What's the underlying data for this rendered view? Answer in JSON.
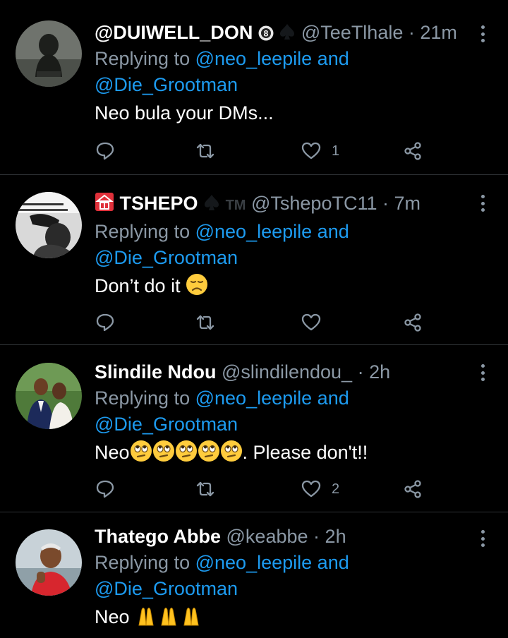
{
  "replies": [
    {
      "display_name": "@DUIWELL_DON",
      "handle": "@TeeTlhale",
      "time": "21m",
      "replying_label": "Replying to",
      "mention_1": "@neo_leepile",
      "and_label": "and",
      "mention_2": "@Die_Grootman",
      "text": "Neo bula your DMs...",
      "likes": "1",
      "retweets": "",
      "avatar_icon": "hooded-figure-avatar",
      "name_badges": [
        "8-ball-icon",
        "spade-icon"
      ]
    },
    {
      "display_name": "TSHEPO",
      "name_tm": "TM",
      "handle": "@TshepoTC11",
      "time": "7m",
      "replying_label": "Replying to",
      "mention_1": "@neo_leepile",
      "and_label": "and",
      "mention_2": "@Die_Grootman",
      "text": "Don’t do it",
      "likes": "",
      "avatar_icon": "photo-with-text-avatar",
      "name_badges": [
        "red-dot-icon",
        "spade-icon"
      ],
      "text_emoji": "disappointed-face"
    },
    {
      "display_name": "Slindile Ndou",
      "handle": "@slindilendou_",
      "time": "2h",
      "replying_label": "Replying to",
      "mention_1": "@neo_leepile",
      "and_label": "and",
      "mention_2": "@Die_Grootman",
      "text_before": "Neo",
      "text_after": ". Please don't!!",
      "likes": "2",
      "avatar_icon": "couple-photo-avatar",
      "text_emoji": "eye-roll-face-x5"
    },
    {
      "display_name": "Thatego Abbe",
      "handle": "@keabbe",
      "time": "2h",
      "replying_label": "Replying to",
      "mention_1": "@neo_leepile",
      "and_label": "and",
      "mention_2": "@Die_Grootman",
      "text": "Neo",
      "avatar_icon": "man-red-shirt-avatar",
      "text_emoji": "folded-hands-x3"
    }
  ],
  "colors": {
    "background": "#000000",
    "muted": "#8b98a5",
    "link": "#1d9bf0",
    "divider": "#2f3336"
  },
  "separator": "·"
}
